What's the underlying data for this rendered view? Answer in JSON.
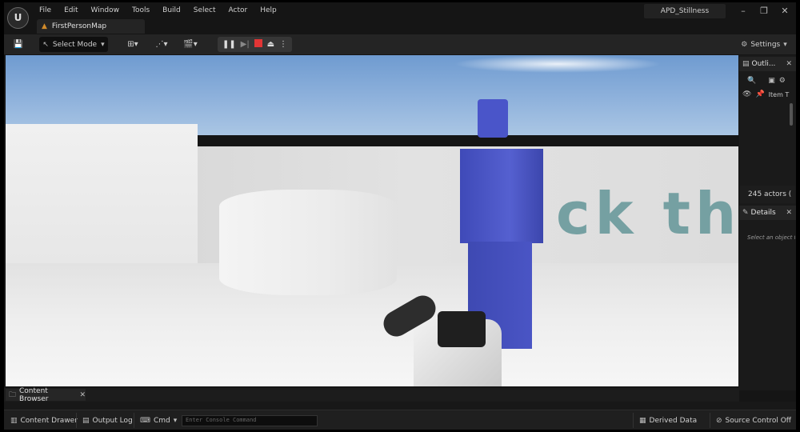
{
  "titlebar": {
    "menu": [
      "File",
      "Edit",
      "Window",
      "Tools",
      "Build",
      "Select",
      "Actor",
      "Help"
    ],
    "map_tab": "FirstPersonMap",
    "project_name": "APD_Stillness"
  },
  "toolbar": {
    "mode_label": "Select Mode",
    "settings_label": "Settings"
  },
  "viewport": {
    "wall_text": "ck the"
  },
  "outliner": {
    "tab_label": "Outli...",
    "column_label": "Item T",
    "actor_count": "245 actors ("
  },
  "details": {
    "tab_label": "Details",
    "hint": "Select an object to"
  },
  "drawer": {
    "content_browser_tab": "Content Browser"
  },
  "statusbar": {
    "content_drawer": "Content Drawer",
    "output_log": "Output Log",
    "cmd_label": "Cmd",
    "console_placeholder": "Enter Console Command",
    "derived_data": "Derived Data",
    "source_control": "Source Control Off"
  },
  "colors": {
    "mannequin_blue": "#4a55c9",
    "stop_red": "#e23535",
    "map_icon_orange": "#d08a2a"
  }
}
